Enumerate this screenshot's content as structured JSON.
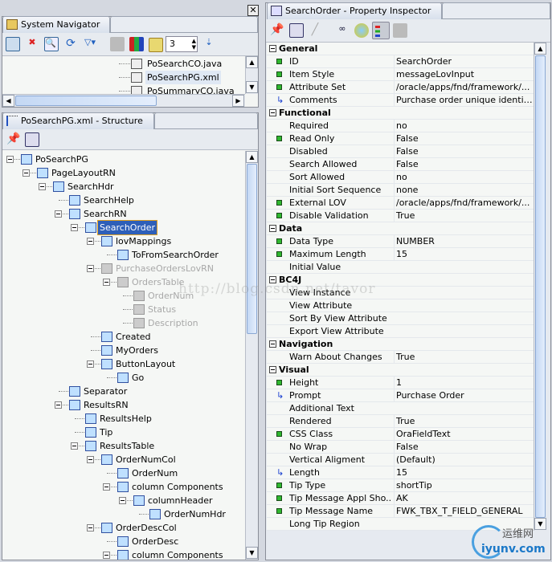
{
  "navigator": {
    "tab_label": "System Navigator",
    "depth_value": "3",
    "files": [
      {
        "name": "PoSearchCO.java",
        "selected": false
      },
      {
        "name": "PoSearchPG.xml",
        "selected": true
      },
      {
        "name": "PoSummaryCO.java",
        "selected": false
      }
    ]
  },
  "structure": {
    "tab_label": "PoSearchPG.xml - Structure",
    "tree": [
      {
        "label": "PoSearchPG",
        "level": 0,
        "expanded": true,
        "icon": "page-icon"
      },
      {
        "label": "PageLayoutRN",
        "level": 1,
        "expanded": true,
        "icon": "page-layout-icon"
      },
      {
        "label": "SearchHdr",
        "level": 2,
        "expanded": true,
        "icon": "header-icon"
      },
      {
        "label": "SearchHelp",
        "level": 3,
        "icon": "static-text-icon"
      },
      {
        "label": "SearchRN",
        "level": 3,
        "expanded": true,
        "icon": "region-icon"
      },
      {
        "label": "SearchOrder",
        "level": 4,
        "expanded": true,
        "icon": "lov-input-icon",
        "selected": true
      },
      {
        "label": "lovMappings",
        "level": 5,
        "expanded": true,
        "icon": "lov-mappings-icon"
      },
      {
        "label": "ToFromSearchOrder",
        "level": 6,
        "icon": "lov-map-icon"
      },
      {
        "label": "PurchaseOrdersLovRN",
        "level": 5,
        "expanded": true,
        "icon": "region-icon",
        "disabled": true
      },
      {
        "label": "OrdersTable",
        "level": 6,
        "expanded": true,
        "icon": "table-icon",
        "disabled": true
      },
      {
        "label": "OrderNum",
        "level": 7,
        "icon": "item-icon",
        "disabled": true
      },
      {
        "label": "Status",
        "level": 7,
        "icon": "item-icon",
        "disabled": true
      },
      {
        "label": "Description",
        "level": 7,
        "icon": "item-icon",
        "disabled": true
      },
      {
        "label": "Created",
        "level": 5,
        "icon": "message-choice-icon"
      },
      {
        "label": "MyOrders",
        "level": 5,
        "icon": "message-choice-icon"
      },
      {
        "label": "ButtonLayout",
        "level": 5,
        "expanded": true,
        "icon": "row-layout-icon"
      },
      {
        "label": "Go",
        "level": 6,
        "icon": "button-icon"
      },
      {
        "label": "Separator",
        "level": 3,
        "icon": "separator-icon"
      },
      {
        "label": "ResultsRN",
        "level": 3,
        "expanded": true,
        "icon": "header-icon"
      },
      {
        "label": "ResultsHelp",
        "level": 4,
        "icon": "static-text-icon"
      },
      {
        "label": "Tip",
        "level": 4,
        "icon": "tip-icon"
      },
      {
        "label": "ResultsTable",
        "level": 4,
        "expanded": true,
        "icon": "table-icon"
      },
      {
        "label": "OrderNumCol",
        "level": 5,
        "expanded": true,
        "icon": "column-icon"
      },
      {
        "label": "OrderNum",
        "level": 6,
        "icon": "item-icon"
      },
      {
        "label": "column Components",
        "level": 6,
        "expanded": true,
        "icon": "folder-icon"
      },
      {
        "label": "columnHeader",
        "level": 7,
        "expanded": true,
        "icon": "column-header-icon"
      },
      {
        "label": "OrderNumHdr",
        "level": 8,
        "icon": "sort-header-icon"
      },
      {
        "label": "OrderDescCol",
        "level": 5,
        "expanded": true,
        "icon": "column-icon"
      },
      {
        "label": "OrderDesc",
        "level": 6,
        "icon": "item-icon"
      },
      {
        "label": "column Components",
        "level": 6,
        "expanded": true,
        "icon": "folder-icon"
      }
    ]
  },
  "inspector": {
    "tab_label": "SearchOrder - Property Inspector",
    "rows": [
      {
        "category": "General"
      },
      {
        "name": "ID",
        "value": "SearchOrder",
        "marker": "set"
      },
      {
        "name": "Item Style",
        "value": "messageLovInput",
        "marker": "set"
      },
      {
        "name": "Attribute Set",
        "value": "/oracle/apps/fnd/framework/...",
        "marker": "set"
      },
      {
        "name": "Comments",
        "value": "Purchase order unique identifi...",
        "marker": "inherited"
      },
      {
        "category": "Functional"
      },
      {
        "name": "Required",
        "value": "no"
      },
      {
        "name": "Read Only",
        "value": "False",
        "marker": "set"
      },
      {
        "name": "Disabled",
        "value": "False"
      },
      {
        "name": "Search Allowed",
        "value": "False"
      },
      {
        "name": "Sort Allowed",
        "value": "no"
      },
      {
        "name": "Initial Sort Sequence",
        "value": "none"
      },
      {
        "name": "External LOV",
        "value": "/oracle/apps/fnd/framework/...",
        "marker": "set"
      },
      {
        "name": "Disable Validation",
        "value": "True",
        "marker": "set"
      },
      {
        "category": "Data"
      },
      {
        "name": "Data Type",
        "value": "NUMBER",
        "marker": "set"
      },
      {
        "name": "Maximum Length",
        "value": "15",
        "marker": "set"
      },
      {
        "name": "Initial Value",
        "value": ""
      },
      {
        "category": "BC4J"
      },
      {
        "name": "View Instance",
        "value": ""
      },
      {
        "name": "View Attribute",
        "value": ""
      },
      {
        "name": "Sort By View Attribute",
        "value": ""
      },
      {
        "name": "Export View Attribute",
        "value": ""
      },
      {
        "category": "Navigation"
      },
      {
        "name": "Warn About Changes",
        "value": "True"
      },
      {
        "category": "Visual"
      },
      {
        "name": "Height",
        "value": "1",
        "marker": "set"
      },
      {
        "name": "Prompt",
        "value": "Purchase Order",
        "marker": "inherited"
      },
      {
        "name": "Additional Text",
        "value": ""
      },
      {
        "name": "Rendered",
        "value": "True"
      },
      {
        "name": "CSS Class",
        "value": "OraFieldText",
        "marker": "set"
      },
      {
        "name": "No Wrap",
        "value": "False"
      },
      {
        "name": "Vertical Aligment",
        "value": "(Default)"
      },
      {
        "name": "Length",
        "value": "15",
        "marker": "inherited"
      },
      {
        "name": "Tip Type",
        "value": "shortTip",
        "marker": "set"
      },
      {
        "name": "Tip Message Appl Sho...",
        "value": "AK",
        "marker": "set"
      },
      {
        "name": "Tip Message Name",
        "value": "FWK_TBX_T_FIELD_GENERAL",
        "marker": "set"
      },
      {
        "name": "Long Tip Region",
        "value": ""
      }
    ]
  },
  "watermark": {
    "text": "http://blog.csdn.net/tavor",
    "logo_cn": "运维网",
    "logo_en": "iyunv.com"
  },
  "colors": {
    "selection": "#2e5fb8",
    "set_marker": "#2fb82f",
    "inherited_marker": "#1a40d0"
  }
}
